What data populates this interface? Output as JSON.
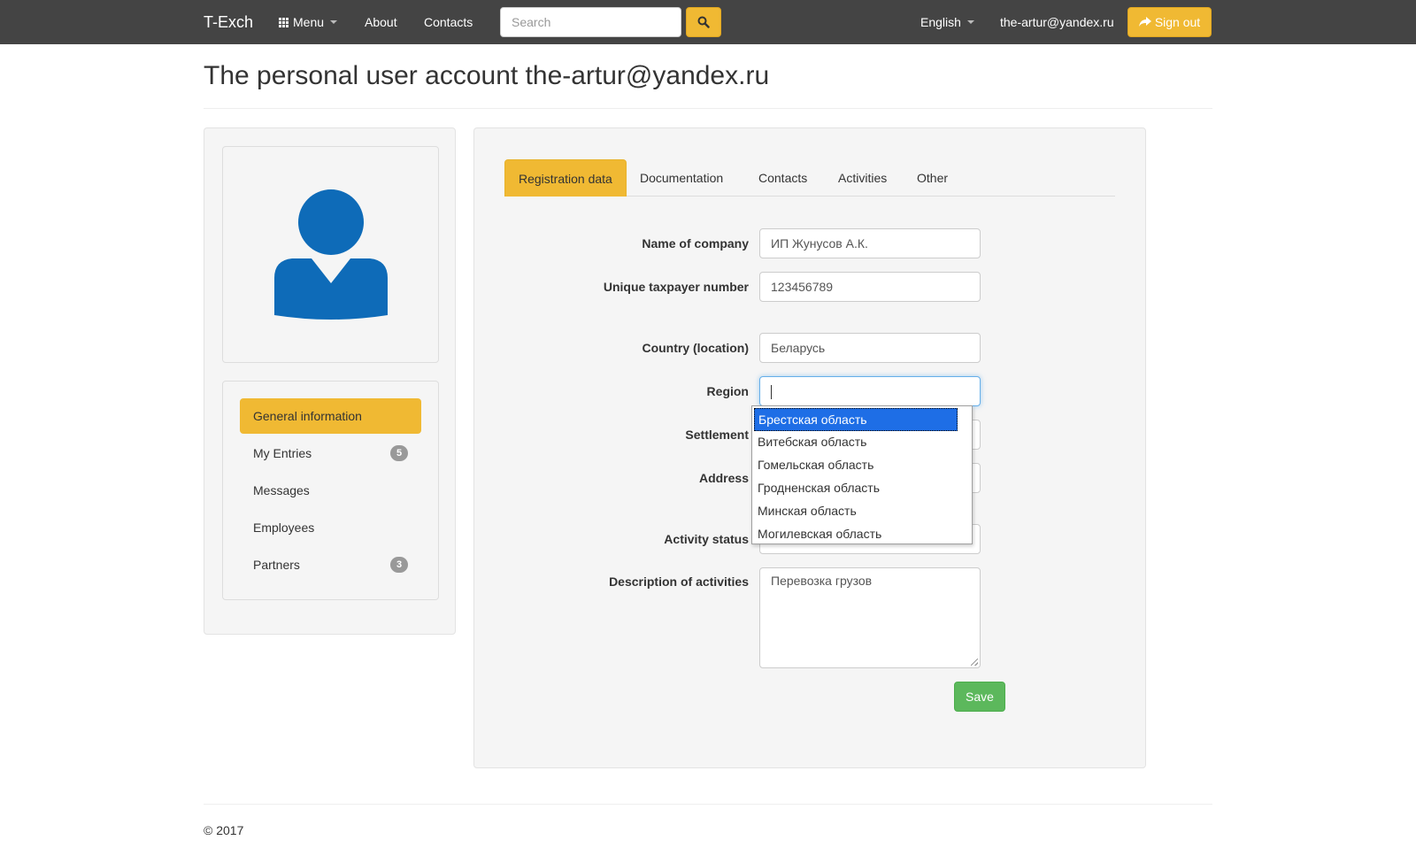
{
  "navbar": {
    "brand": "T-Exch",
    "menu_label": "Menu",
    "about": "About",
    "contacts": "Contacts",
    "search_placeholder": "Search",
    "language": "English",
    "user_email": "the-artur@yandex.ru",
    "signout_label": "Sign out"
  },
  "page": {
    "title": "The personal user account the-artur@yandex.ru"
  },
  "sidebar": {
    "items": [
      {
        "label": "General information",
        "badge": null,
        "active": true
      },
      {
        "label": "My Entries",
        "badge": "5",
        "active": false
      },
      {
        "label": "Messages",
        "badge": null,
        "active": false
      },
      {
        "label": "Employees",
        "badge": null,
        "active": false
      },
      {
        "label": "Partners",
        "badge": "3",
        "active": false
      }
    ]
  },
  "tabs": [
    {
      "label": "Registration data",
      "active": true
    },
    {
      "label": "Documentation",
      "active": false
    },
    {
      "label": "Contacts",
      "active": false
    },
    {
      "label": "Activities",
      "active": false
    },
    {
      "label": "Other",
      "active": false
    }
  ],
  "form": {
    "company_label": "Name of company",
    "company_value": "ИП Жунусов А.К.",
    "taxpayer_label": "Unique taxpayer number",
    "taxpayer_value": "123456789",
    "country_label": "Country (location)",
    "country_value": "Беларусь",
    "region_label": "Region",
    "region_value": "",
    "settlement_label": "Settlement",
    "address_label": "Address",
    "activity_status_label": "Activity status",
    "description_label": "Description of activities",
    "description_value": "Перевозка грузов",
    "save_label": "Save"
  },
  "region_dropdown": {
    "options": [
      "Брестская область",
      "Витебская область",
      "Гомельская область",
      "Гродненская область",
      "Минская область",
      "Могилевская область"
    ],
    "selected_index": 0
  },
  "footer": {
    "copyright": "© 2017"
  },
  "colors": {
    "navbar_bg": "#444444",
    "accent": "#f0b933",
    "save_green": "#5cb85c",
    "avatar_blue": "#0e6bb8",
    "selection_blue": "#1e6ee6"
  },
  "icons": {
    "menu": "grid-icon",
    "search": "search-icon",
    "signout": "share-arrow-icon",
    "avatar": "user-silhouette-icon"
  }
}
